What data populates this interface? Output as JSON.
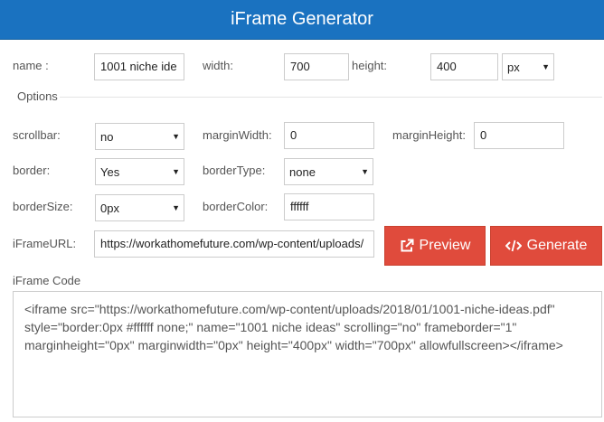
{
  "header": {
    "title": "iFrame Generator"
  },
  "fields": {
    "name": {
      "label": "name :",
      "value": "1001 niche ide"
    },
    "width": {
      "label": "width:",
      "value": "700"
    },
    "height": {
      "label": "height:",
      "value": "400",
      "unit": "px"
    }
  },
  "options": {
    "legend": "Options",
    "scrollbar": {
      "label": "scrollbar:",
      "value": "no"
    },
    "marginWidth": {
      "label": "marginWidth:",
      "value": "0"
    },
    "marginHeight": {
      "label": "marginHeight:",
      "value": "0"
    },
    "border": {
      "label": "border:",
      "value": "Yes"
    },
    "borderType": {
      "label": "borderType:",
      "value": "none"
    },
    "borderSize": {
      "label": "borderSize:",
      "value": "0px"
    },
    "borderColor": {
      "label": "borderColor:",
      "value": "ffffff"
    }
  },
  "url": {
    "label": "iFrameURL:",
    "value": "https://workathomefuture.com/wp-content/uploads/"
  },
  "buttons": {
    "preview": "Preview",
    "generate": "Generate"
  },
  "code": {
    "label": "iFrame Code",
    "value": "<iframe src=\"https://workathomefuture.com/wp-content/uploads/2018/01/1001-niche-ideas.pdf\" style=\"border:0px #ffffff none;\" name=\"1001 niche ideas\" scrolling=\"no\" frameborder=\"1\" marginheight=\"0px\" marginwidth=\"0px\" height=\"400px\" width=\"700px\" allowfullscreen></iframe>"
  },
  "colors": {
    "header": "#1a72c0",
    "button": "#e04b3c"
  },
  "icons": {
    "preview": "external-link-icon",
    "generate": "code-icon",
    "select": "caret-down-icon"
  }
}
